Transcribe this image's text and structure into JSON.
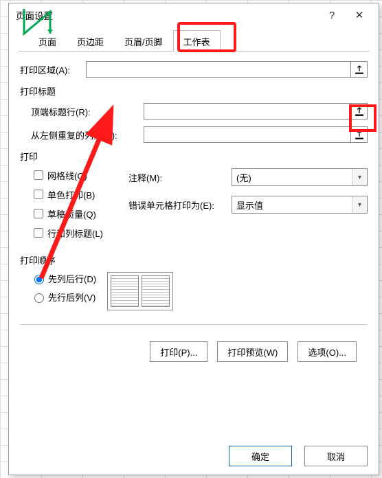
{
  "window": {
    "title": "页面设置",
    "help_symbol": "?",
    "close_symbol": "✕"
  },
  "tabs": {
    "page": "页面",
    "margins": "页边距",
    "headerfooter": "页眉/页脚",
    "sheet": "工作表"
  },
  "fields": {
    "print_area_label": "打印区域(A):",
    "print_area_value": "",
    "print_titles_section": "打印标题",
    "rows_repeat_label": "顶端标题行(R):",
    "rows_repeat_value": "",
    "cols_repeat_label": "从左侧重复的列数(C):",
    "cols_repeat_value": "",
    "print_section": "打印",
    "gridlines_label": "网格线(G)",
    "bw_label": "单色打印(B)",
    "draft_label": "草稿质量(Q)",
    "rowcol_headings_label": "行和列标题(L)",
    "comments_label": "注释(M):",
    "comments_value": "(无)",
    "errors_label": "错误单元格打印为(E):",
    "errors_value": "显示值",
    "order_section": "打印顺序",
    "order_down_label": "先列后行(D)",
    "order_over_label": "先行后列(V)"
  },
  "buttons": {
    "print": "打印(P)...",
    "preview": "打印预览(W)",
    "options": "选项(O)...",
    "ok": "确定",
    "cancel": "取消"
  }
}
